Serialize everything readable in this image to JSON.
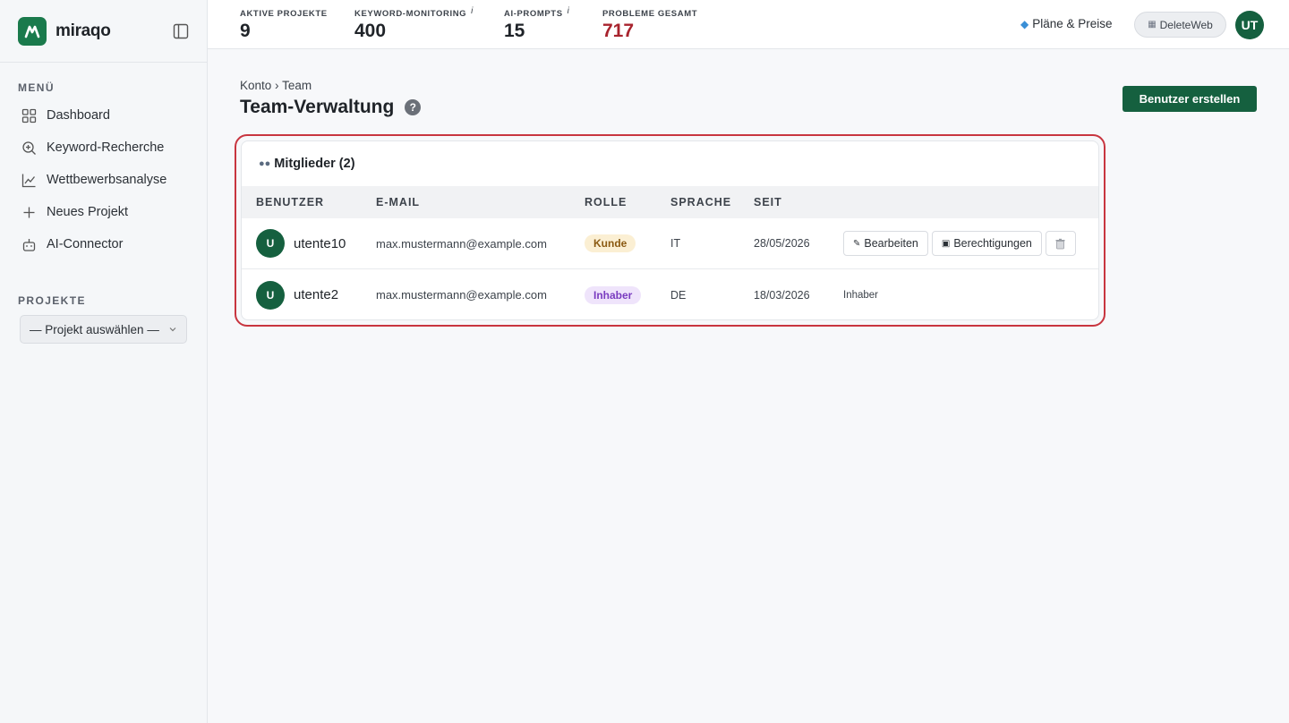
{
  "brand": {
    "name": "miraqo",
    "logo_icon": "m-logo-icon"
  },
  "sidebar": {
    "menu_label": "MENÜ",
    "items": [
      {
        "label": "Dashboard",
        "icon": "grid-icon"
      },
      {
        "label": "Keyword-Recherche",
        "icon": "search-plus-icon"
      },
      {
        "label": "Wettbewerbsanalyse",
        "icon": "line-chart-icon"
      },
      {
        "label": "Neues Projekt",
        "icon": "plus-icon"
      },
      {
        "label": "AI-Connector",
        "icon": "robot-icon"
      }
    ],
    "projects_label": "PROJEKTE",
    "project_select_value": "— Projekt auswählen —"
  },
  "topbar": {
    "stats": [
      {
        "label": "AKTIVE PROJEKTE",
        "value": "9",
        "info": ""
      },
      {
        "label": "KEYWORD-MONITORING",
        "value": "400",
        "info": "i"
      },
      {
        "label": "AI-PROMPTS",
        "value": "15",
        "info": "i"
      },
      {
        "label": "PROBLEME GESAMT",
        "value": "717",
        "info": ""
      }
    ],
    "plans_label": "Pläne & Preise",
    "workspace_label": "DeleteWeb",
    "user_initials": "UT"
  },
  "main": {
    "breadcrumb": {
      "parent": "Konto",
      "sep": "›",
      "current": "Team"
    },
    "title": "Team-Verwaltung",
    "help": "?",
    "create_button": "Benutzer erstellen"
  },
  "members": {
    "heading": "Mitglieder (2)",
    "columns": [
      "BENUTZER",
      "E-MAIL",
      "ROLLE",
      "SPRACHE",
      "SEIT"
    ],
    "rows": [
      {
        "initial": "U",
        "username": "utente10",
        "email": "max.mustermann@example.com",
        "role": "Kunde",
        "language": "IT",
        "since": "28/05/2026",
        "edit": "Bearbeiten",
        "permissions": "Berechtigungen",
        "note": ""
      },
      {
        "initial": "U",
        "username": "utente2",
        "email": "max.mustermann@example.com",
        "role": "Inhaber",
        "language": "DE",
        "since": "18/03/2026",
        "edit": "",
        "permissions": "",
        "note": "Inhaber"
      }
    ]
  },
  "colors": {
    "brand_green": "#15603f",
    "alert_red": "#a8232d",
    "highlight": "#c8353f"
  }
}
